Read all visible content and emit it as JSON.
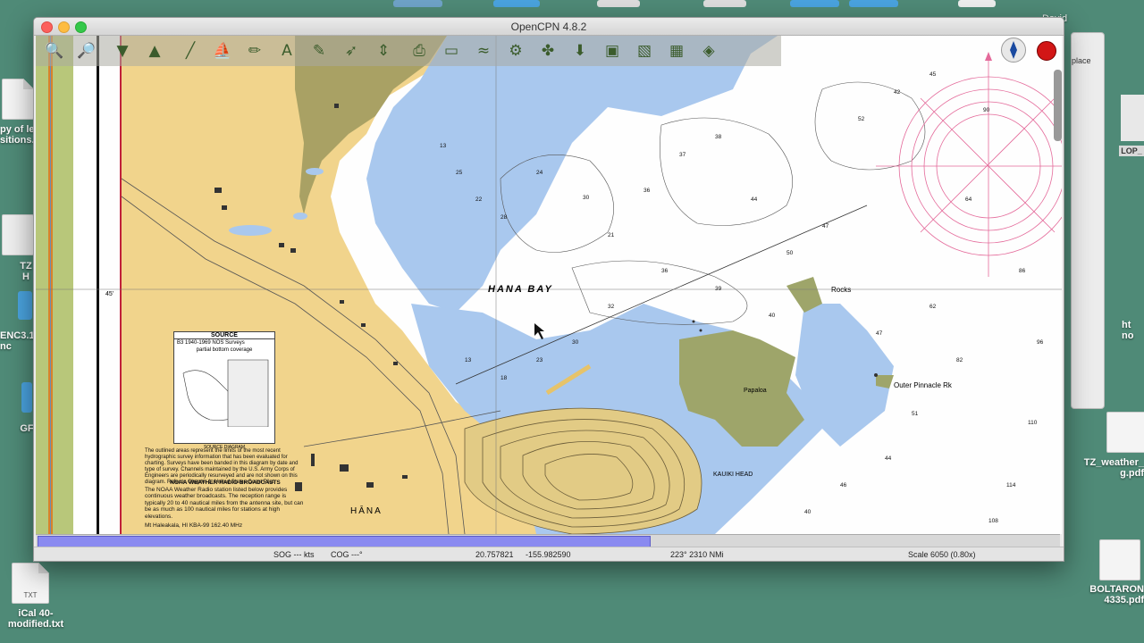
{
  "app": {
    "title": "OpenCPN 4.8.2"
  },
  "toolbar": {
    "buttons": [
      {
        "name": "zoom-in",
        "glyph": "🔍"
      },
      {
        "name": "zoom-out",
        "glyph": "🔎"
      },
      {
        "name": "scale-in",
        "glyph": "▼"
      },
      {
        "name": "scale-out",
        "glyph": "▲"
      },
      {
        "name": "route",
        "glyph": "╱"
      },
      {
        "name": "ship",
        "glyph": "⛵"
      },
      {
        "name": "measure",
        "glyph": "✏"
      },
      {
        "name": "text",
        "glyph": "A"
      },
      {
        "name": "mark",
        "glyph": "✎"
      },
      {
        "name": "track",
        "glyph": "➶"
      },
      {
        "name": "vector",
        "glyph": "⇕"
      },
      {
        "name": "print",
        "glyph": "⎙"
      },
      {
        "name": "route-manager",
        "glyph": "▭"
      },
      {
        "name": "current",
        "glyph": "≈"
      },
      {
        "name": "settings",
        "glyph": "⚙"
      },
      {
        "name": "tides",
        "glyph": "✤"
      },
      {
        "name": "download",
        "glyph": "⬇"
      },
      {
        "name": "aispanel",
        "glyph": "▣"
      },
      {
        "name": "plugin",
        "glyph": "▧"
      },
      {
        "name": "grib",
        "glyph": "▦"
      },
      {
        "name": "layers",
        "glyph": "◈"
      }
    ]
  },
  "chart": {
    "bay_label": "HANA BAY",
    "town_label": "HĀNA",
    "rocks_label": "Rocks",
    "pinnacle_label": "Outer Pinnacle Rk",
    "kauiki_label": "KAUIKI HEAD",
    "papaloa_label": "Papaloa",
    "lat_label": "45'",
    "source": {
      "title": "SOURCE",
      "line1": "B3    1940-1969    NOS Surveys",
      "line2": "partial bottom coverage",
      "footer": "SOURCE DIAGRAM"
    },
    "notes": "The outlined areas represent the limits of the most recent hydrographic survey information that has been evaluated for charting. Surveys have been banded in this diagram by date and type of survey. Channels maintained by the U.S. Army Corps of Engineers are periodically resurveyed and are not shown on this diagram. Refer to Chapter 1, United States Coast Pilot.",
    "noaa": {
      "title": "NOAA WEATHER RADIO BROADCASTS",
      "body": "The NOAA Weather Radio station listed below provides continuous weather broadcasts. The reception range is typically 20 to 40 nautical miles from the antenna site, but can be as much as 100 nautical miles for stations at high elevations.",
      "station": "Mt Haleakala, HI      KBA-99      162.40 MHz"
    }
  },
  "status": {
    "sog": "SOG --- kts",
    "cog": "COG ---°",
    "lat": "20.757821",
    "lon": "-155.982590",
    "bearing": "223°  2310 NMi",
    "scale": "Scale 6050 (0.80x)"
  },
  "scroll": {
    "horizontal_thumb_fraction": 0.6
  },
  "desktop": {
    "icons": [
      {
        "label": "py of le\nsitions."
      },
      {
        "label": "TZ\nH"
      },
      {
        "label": "ENC3.1.\nnc"
      },
      {
        "label": "GF"
      },
      {
        "label": "iCal 40-\nmodified.txt",
        "badge": "TXT"
      },
      {
        "label": "ht\nno"
      },
      {
        "label": "LOP_"
      },
      {
        "label": "TZ_weather_\ng.pdf"
      },
      {
        "label": "BOLTARON\n4335.pdf"
      }
    ],
    "back_window_text": "place",
    "top_right_text": "David"
  }
}
